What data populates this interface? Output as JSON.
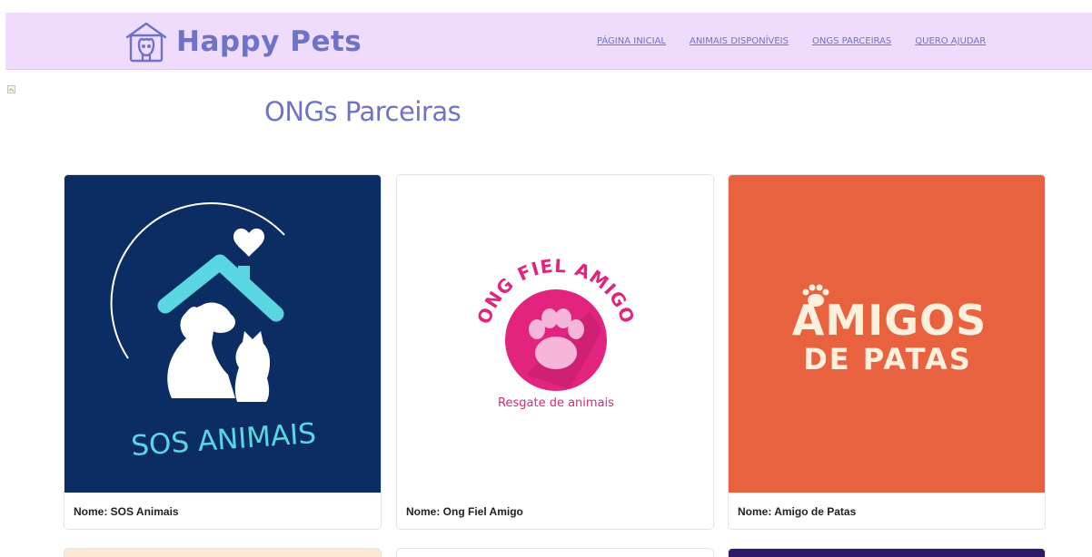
{
  "theme": {
    "header_bg": "#efdcfd",
    "brand_color": "#6e73c9",
    "nav_link_color": "#6e73c9",
    "title_color": "#6e73c9"
  },
  "header": {
    "brand": "Happy Pets",
    "logo_icon": "pet-house-icon",
    "nav": [
      "PÁGINA INICIAL",
      "ANIMAIS DISPONÍVEIS",
      "ONGS PARCEIRAS",
      "QUERO AJUDAR"
    ]
  },
  "main": {
    "title": "ONGs Parceiras",
    "cards": [
      {
        "caption": "Nome: SOS Animais",
        "logo_text": "SOS ANIMAIS",
        "bg": "#0c2d63",
        "accent": "#5ad6e2"
      },
      {
        "caption": "Nome: Ong Fiel Amigo",
        "logo_text": "ONG FIEL AMIGO",
        "logo_subtitle": "Resgate de animais",
        "bg": "#ffffff",
        "accent": "#e2247e"
      },
      {
        "caption": "Nome: Amigo de Patas",
        "logo_line1": "AMIGOS",
        "logo_line2": "DE PATAS",
        "bg": "#e8623f",
        "accent": "#fdf0dc"
      }
    ],
    "next_row_colors": [
      "#fde8d4",
      "#ffffff",
      "#2d1a68"
    ]
  }
}
